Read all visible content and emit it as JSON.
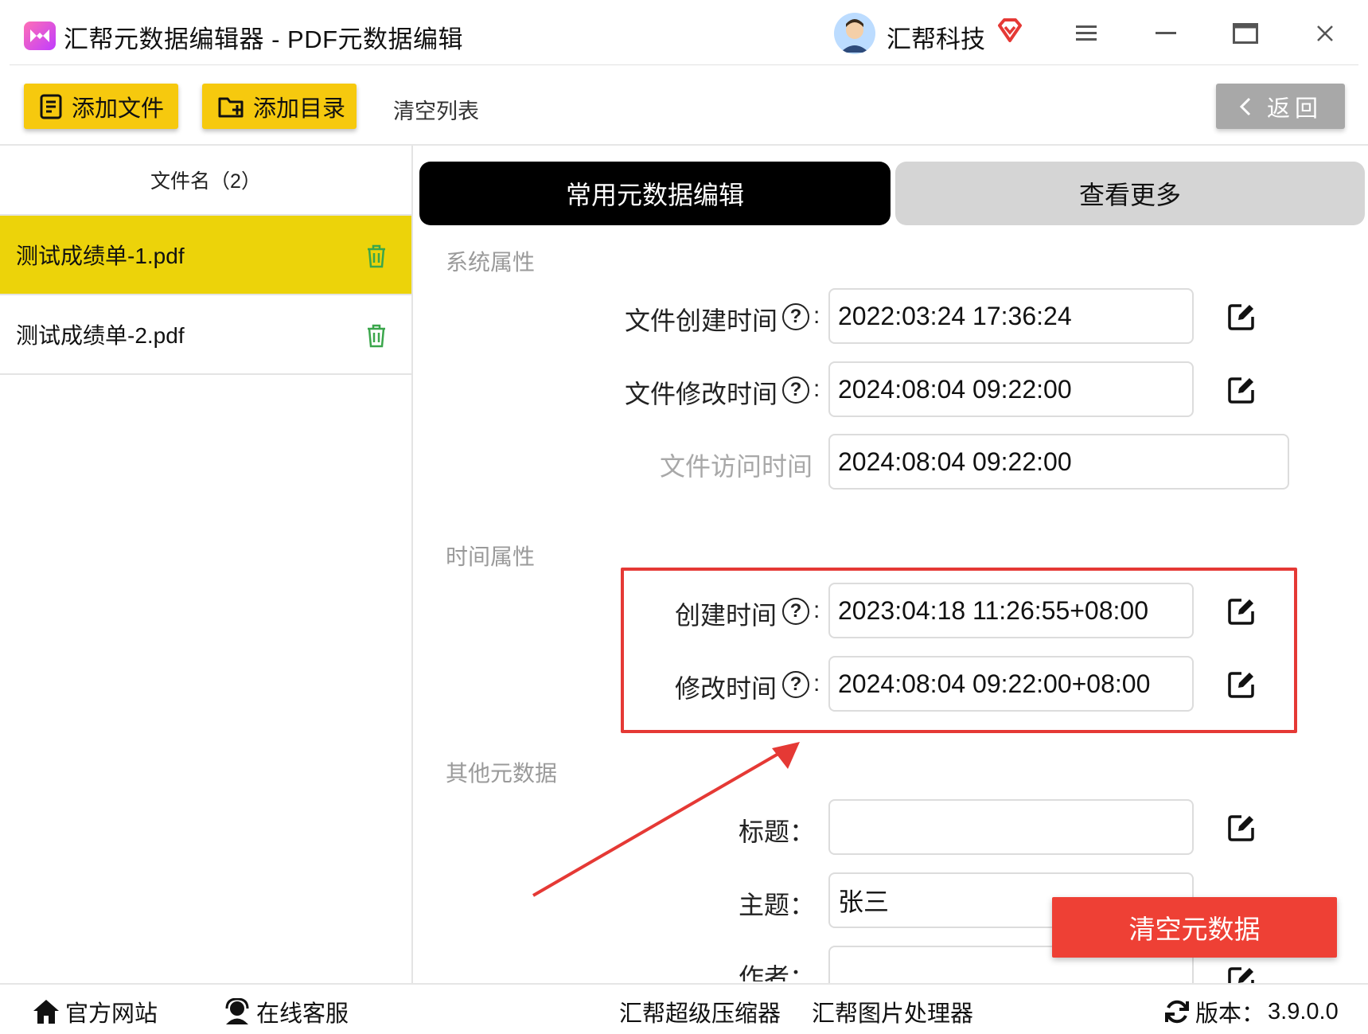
{
  "window": {
    "title": "汇帮元数据编辑器 - PDF元数据编辑",
    "user_name": "汇帮科技",
    "icons": [
      "app-logo-icon",
      "avatar",
      "vip-diamond-icon",
      "menu-icon",
      "minimize-icon",
      "maximize-icon",
      "close-icon"
    ]
  },
  "toolbar": {
    "add_file_label": "添加文件",
    "add_folder_label": "添加目录",
    "clear_list_label": "清空列表",
    "back_label": "返回",
    "accent_color": "#f6c90e"
  },
  "file_list": {
    "header": "文件名（2）",
    "items": [
      {
        "name": "测试成绩单-1.pdf",
        "selected": true
      },
      {
        "name": "测试成绩单-2.pdf",
        "selected": false
      }
    ],
    "selected_color": "#ecd30a"
  },
  "tabs": {
    "active": "常用元数据编辑",
    "inactive": "查看更多"
  },
  "system_props": {
    "title": "系统属性",
    "created_label": "文件创建时间",
    "created_value": "2022:03:24 17:36:24",
    "modified_label": "文件修改时间",
    "modified_value": "2024:08:04 09:22:00",
    "accessed_label": "文件访问时间",
    "accessed_value": "2024:08:04 09:22:00"
  },
  "time_props": {
    "title": "时间属性",
    "created_label": "创建时间",
    "created_value": "2023:04:18 11:26:55+08:00",
    "modified_label": "修改时间",
    "modified_value": "2024:08:04 09:22:00+08:00"
  },
  "other_meta": {
    "title": "其他元数据",
    "title_label": "标题：",
    "title_value": "",
    "subject_label": "主题：",
    "subject_value": "张三",
    "author_label": "作者："
  },
  "help_glyph": "?",
  "colon_glyph": ":",
  "clear_meta_label": "清空元数据",
  "clear_meta_color": "#ee4035",
  "footer": {
    "website": "官方网站",
    "support": "在线客服",
    "compressor": "汇帮超级压缩器",
    "image_tool": "汇帮图片处理器",
    "version_label": "版本：",
    "version_value": "3.9.0.0"
  }
}
